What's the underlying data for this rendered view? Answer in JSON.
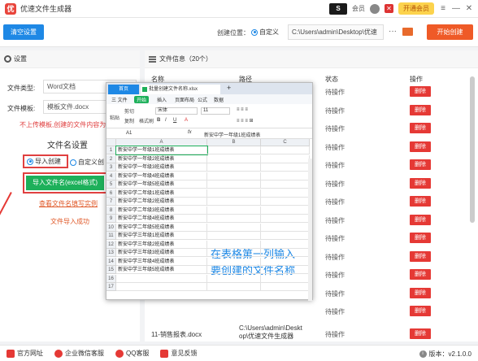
{
  "app": {
    "title": "优速文件生成器",
    "member_label": "会员",
    "vip_button": "开通会员"
  },
  "toolbar": {
    "clear_label": "清空设置",
    "location_label": "创建位置：",
    "custom_label": "自定义",
    "path_value": "C:\\Users\\admin\\Desktop\\优速",
    "more": "···",
    "start_label": "开始创建"
  },
  "left": {
    "header": "设置",
    "file_type_label": "文件类型:",
    "file_type_value": "Word文档",
    "template_label": "文件模板:",
    "template_value": "模板文件.docx",
    "warning": "不上传模板,创建的文件内容为",
    "section_title": "文件名设置",
    "import_radio": "导入创建",
    "custom_radio": "自定义创",
    "import_button": "导入文件名(excel格式)",
    "example_link": "查看文件名填写实例",
    "import_status": "文件导入成功"
  },
  "right": {
    "header": "文件信息（20个）",
    "col_name": "名称",
    "col_path": "路径",
    "col_status": "状态",
    "col_action": "操作",
    "rows": [
      {
        "status": "待操作",
        "action": "删除"
      },
      {
        "status": "待操作",
        "action": "删除"
      },
      {
        "status": "待操作",
        "action": "删除"
      },
      {
        "status": "待操作",
        "action": "删除"
      },
      {
        "status": "待操作",
        "action": "删除"
      },
      {
        "status": "待操作",
        "action": "删除"
      },
      {
        "status": "待操作",
        "action": "删除"
      },
      {
        "status": "待操作",
        "action": "删除"
      },
      {
        "status": "待操作",
        "action": "删除"
      },
      {
        "status": "待操作",
        "action": "删除"
      },
      {
        "status": "待操作",
        "action": "删除"
      },
      {
        "status": "待操作",
        "action": "删除"
      },
      {
        "status": "待操作",
        "action": "删除"
      }
    ],
    "last_row": {
      "name": "11-销售报表.docx",
      "path_line1": "C:\\Users\\admin\\Deskt",
      "path_line2": "op\\优速文件生成器",
      "status": "待操作",
      "action": "删除"
    }
  },
  "statusbar": {
    "website": "官方网址",
    "wechat": "企业微信客服",
    "qq": "QQ客服",
    "feedback": "意见反馈",
    "version": "版本：v2.1.0.0"
  },
  "sheet": {
    "home_tab": "首页",
    "file_tab": "批量创建文件名称.xlsx",
    "plus": "+",
    "ribbon_tabs": [
      "三 文件",
      "开始",
      "插入",
      "页面布局",
      "公式",
      "数据"
    ],
    "cell_ref": "A1",
    "fx": "fx",
    "formula_value": "新安中学一年级1班成绩表",
    "font_name": "宋体",
    "font_size": "11",
    "tool_paste": "粘贴",
    "tool_cut": "剪切",
    "tool_copy": "复制",
    "tool_format": "格式刷",
    "col_a": "A",
    "col_b": "B",
    "col_c": "C",
    "cells": [
      "新安中学一年级1班成绩表",
      "新安中学一年级2班成绩表",
      "新安中学一年级3班成绩表",
      "新安中学一年级4班成绩表",
      "新安中学一年级5班成绩表",
      "新安中学二年级1班成绩表",
      "新安中学二年级2班成绩表",
      "新安中学二年级3班成绩表",
      "新安中学二年级4班成绩表",
      "新安中学二年级5班成绩表",
      "新安中学三年级1班成绩表",
      "新安中学三年级2班成绩表",
      "新安中学三年级3班成绩表",
      "新安中学三年级4班成绩表",
      "新安中学三年级5班成绩表"
    ],
    "row_numbers": [
      "1",
      "2",
      "3",
      "4",
      "5",
      "6",
      "7",
      "8",
      "9",
      "10",
      "11",
      "12",
      "13",
      "14",
      "15",
      "16",
      "17"
    ],
    "callout_line1": "在表格第一列输入",
    "callout_line2": "要创建的文件名称"
  }
}
